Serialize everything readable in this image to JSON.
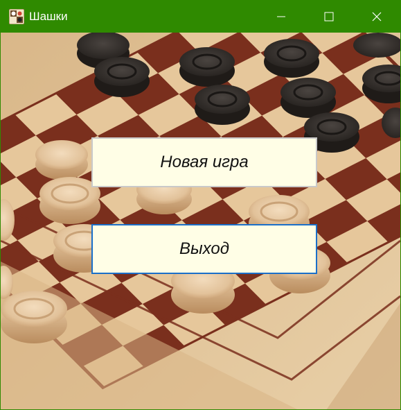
{
  "window": {
    "title": "Шашки",
    "icon": "checkers-board-icon",
    "controls": {
      "minimize": "minimize-icon",
      "maximize": "maximize-icon",
      "close": "close-icon"
    },
    "titlebar_color": "#2f8a00"
  },
  "menu": {
    "new_game_label": "Новая игра",
    "exit_label": "Выход",
    "button_background": "#fffee6",
    "focus_border_color": "#1a6fc9"
  },
  "background": {
    "image": "wooden-checkers-board-photo"
  }
}
